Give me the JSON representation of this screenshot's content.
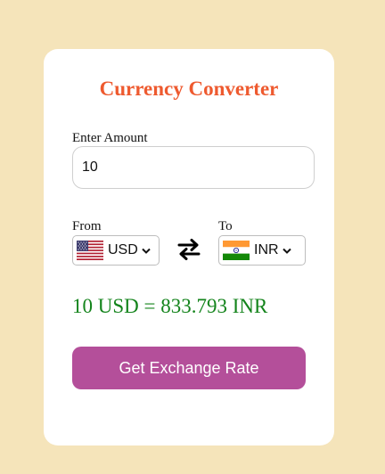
{
  "app": {
    "title": "Currency Converter"
  },
  "amount": {
    "label": "Enter Amount",
    "value": "10"
  },
  "from": {
    "label": "From",
    "currency": "USD",
    "flag_icon": "us-flag-icon"
  },
  "to": {
    "label": "To",
    "currency": "INR",
    "flag_icon": "india-flag-icon"
  },
  "swap": {
    "icon": "swap-arrows-icon"
  },
  "result": {
    "text": "10 USD = 833.793 INR"
  },
  "action": {
    "button_label": "Get Exchange Rate"
  },
  "colors": {
    "background": "#f5e4ba",
    "card": "#ffffff",
    "title": "#ee5a2f",
    "result": "#14841c",
    "button": "#b44f9a",
    "button_text": "#ffffff"
  }
}
